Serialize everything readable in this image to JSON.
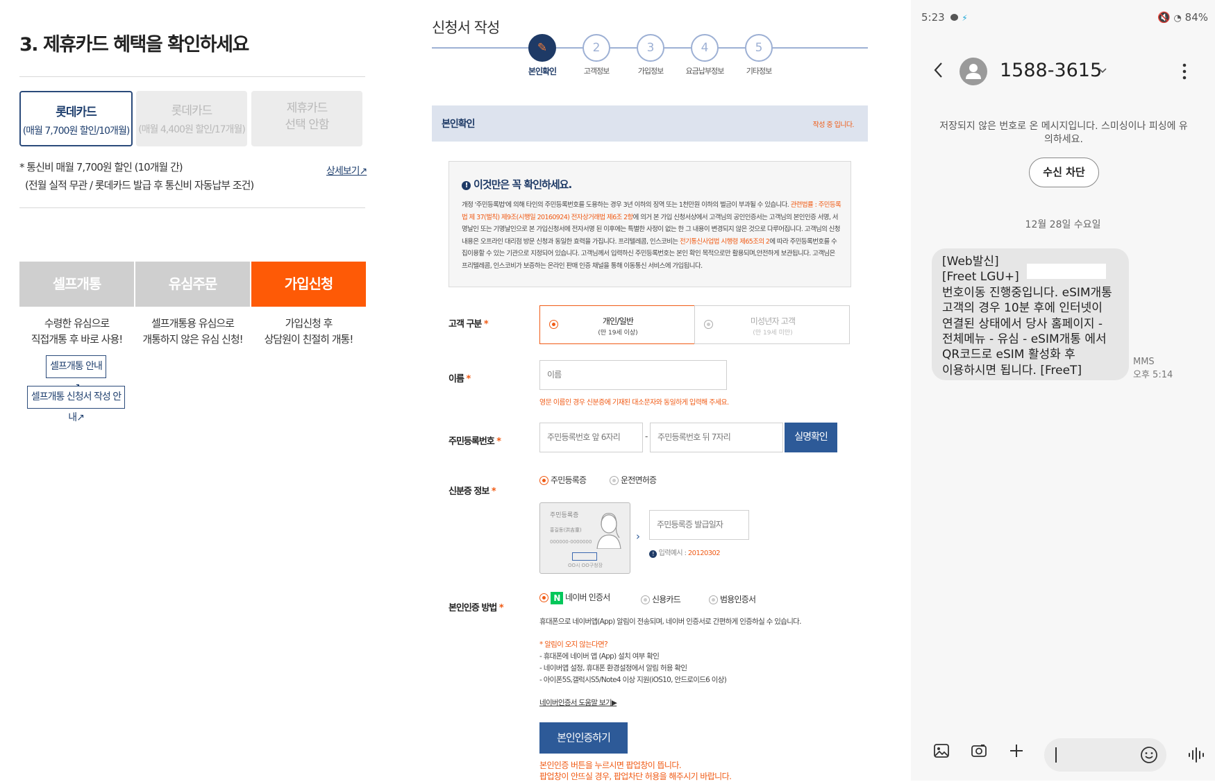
{
  "left": {
    "title": "3. 제휴카드 혜택을 확인하세요",
    "cards": [
      {
        "name": "롯데카드",
        "sub": "(매월 7,700원 할인/10개월)"
      },
      {
        "name": "롯데카드",
        "sub": "(매월 4,400원 할인/17개월)"
      },
      {
        "name": "제휴카드",
        "sub": "선택 안함"
      }
    ],
    "benefit_line1": "* 통신비 매월 7,700원 할인 (10개월 간)",
    "benefit_line2": "(전월 실적 무관 / 롯데카드 발급 후 통신비 자동납부 조건)",
    "detail_link": "상세보기↗",
    "tabs": [
      {
        "label": "셀프개통",
        "desc1": "수령한 유심으로",
        "desc2": "직접개통 후 바로 사용!"
      },
      {
        "label": "유심주문",
        "desc1": "셀프개통용 유심으로",
        "desc2": "개통하지 않은 유심 신청!"
      },
      {
        "label": "가입신청",
        "desc1": "가입신청 후",
        "desc2": "상담원이 친절히 개통!"
      }
    ],
    "guide_btn1": "셀프개통 안내↗",
    "guide_btn2": "셀프개통 신청서 작성 안내↗"
  },
  "mid": {
    "title": "신청서 작성",
    "steps": [
      {
        "num": "✎",
        "label": "본인확인"
      },
      {
        "num": "2",
        "label": "고객정보"
      },
      {
        "num": "3",
        "label": "가입정보"
      },
      {
        "num": "4",
        "label": "요금납부정보"
      },
      {
        "num": "5",
        "label": "기타정보"
      }
    ],
    "section_title": "본인확인",
    "section_status": "작성 중 입니다.",
    "notice_title": "이것만은 꼭 확인하세요.",
    "notice_p1": "개정 '주민등록법'에 의해 타인의 주민등록번호를 도용하는 경우 3년 이하의 징역 또는 1천만원 이하의 벌금이 부과될 수 있습니다. ",
    "notice_red1": "관련법률 : 주민등록법 제 37(벌칙) 제9조(시행일 20160924) 전자상거래법 제6조 2항",
    "notice_p2": "에 의거 본 가입 신청서상에서 고객님의 공인인증서는 고객님의 본인인증 서명, 서명날인 또는 기명날인으로 본 가입신청서에 전자서명 된 이후에는 특별한 사정이 없는 한 그 내용이 변경되지 않은 것으로 다루어집니다. 고객님의 신청내용은 오프라인 대리점 방문 신청과 동일한 효력을 가집니다. 프리텔레콤, 인스코비는 ",
    "notice_red2": "전기통신사업법 시행령 제65조의 2",
    "notice_p3": "에 따라 주민등록번호를 수집이용할 수 있는 기관으로 지정되어 있습니다. 고객님께서 입력하신 주민등록번호는 본인 확인 목적으로만 활용되며,안전하게 보관됩니다. 고객님은 프리텔레콤, 인스코비가 보증하는 온라인 판매 인증 채널을 통해 이동통신 서비스에 가입됩니다.",
    "customer_type_label": "고객 구분",
    "type_personal": "개인/일반",
    "type_personal_sub": "(만 19세 이상)",
    "type_minor": "미성년자 고객",
    "type_minor_sub": "(만 19세 미만)",
    "name_label": "이름",
    "name_placeholder": "이름",
    "name_hint": "영문 이름인 경우 신분증에 기재된 대소문자와 동일하게 입력해 주세요.",
    "rrn_label": "주민등록번호",
    "rrn_front_placeholder": "주민등록번호 앞 6자리",
    "rrn_dash": "-",
    "rrn_back_placeholder": "주민등록번호 뒤 7자리",
    "verify_btn": "실명확인",
    "id_label": "신분증 정보",
    "id_opt1": "주민등록증",
    "id_opt2": "운전면허증",
    "id_card_title": "주민등록증",
    "id_card_name": "홍길동(洪吉童)",
    "id_card_num": "000000-0000000",
    "id_card_office": "OO시 OO구청장",
    "issue_placeholder": "주민등록증 발급일자",
    "issue_example_label": "입력예시 : ",
    "issue_example_value": "20120302",
    "auth_label": "본인인증 방법",
    "auth_opt1": "네이버 인증서",
    "auth_opt2": "신용카드",
    "auth_opt3": "범용인증서",
    "auth_desc": "휴대폰으로 네이버앱(App) 알림이 전송되며, 네이버 인증서로 간편하게 인증하실 수 있습니다.",
    "auth_notice_title": "* 알림이 오지 않는다면?",
    "auth_notice1": "- 휴대폰에 네이버 앱 (App) 설치 여부 확인",
    "auth_notice2": "- 네이버앱 설정, 휴대폰 환경설정에서 알림 허용 확인",
    "auth_notice3": "- 아이폰5S,갤럭시S5/Note4 이상 지원(iOS10, 안드로이드6 이상)",
    "help_link": "네이버인증서 도움말 보기▶",
    "auth_btn": "본인인증하기",
    "popup_note1": "본인인증 버튼을 누르시면 팝업창이 뜹니다.",
    "popup_note2": "팝업창이 안뜨실 경우, 팝업차단 허용을 해주시기 바랍니다."
  },
  "phone": {
    "time": "5:23",
    "battery": "84%",
    "number": "1588-3615",
    "warning": "저장되지 않은 번호로 온 메시지입니다. 스미싱이나 피싱에 유의하세요.",
    "block_btn": "수신 차단",
    "date": "12월 28일 수요일",
    "message_lines": [
      "[Web발신]",
      "[Freet LGU+]",
      "번호이동 진행중입니다. eSIM개통",
      "고객의 경우 10분 후에 인터넷이",
      "연결된 상태에서 당사 홈페이지 -",
      "전체메뉴 - 유심 - eSIM개통 에서",
      "QR코드로 eSIM 활성화 후",
      "이용하시면 됩니다.  [FreeT]"
    ],
    "msg_type": "MMS",
    "msg_time": "오후 5:14"
  }
}
